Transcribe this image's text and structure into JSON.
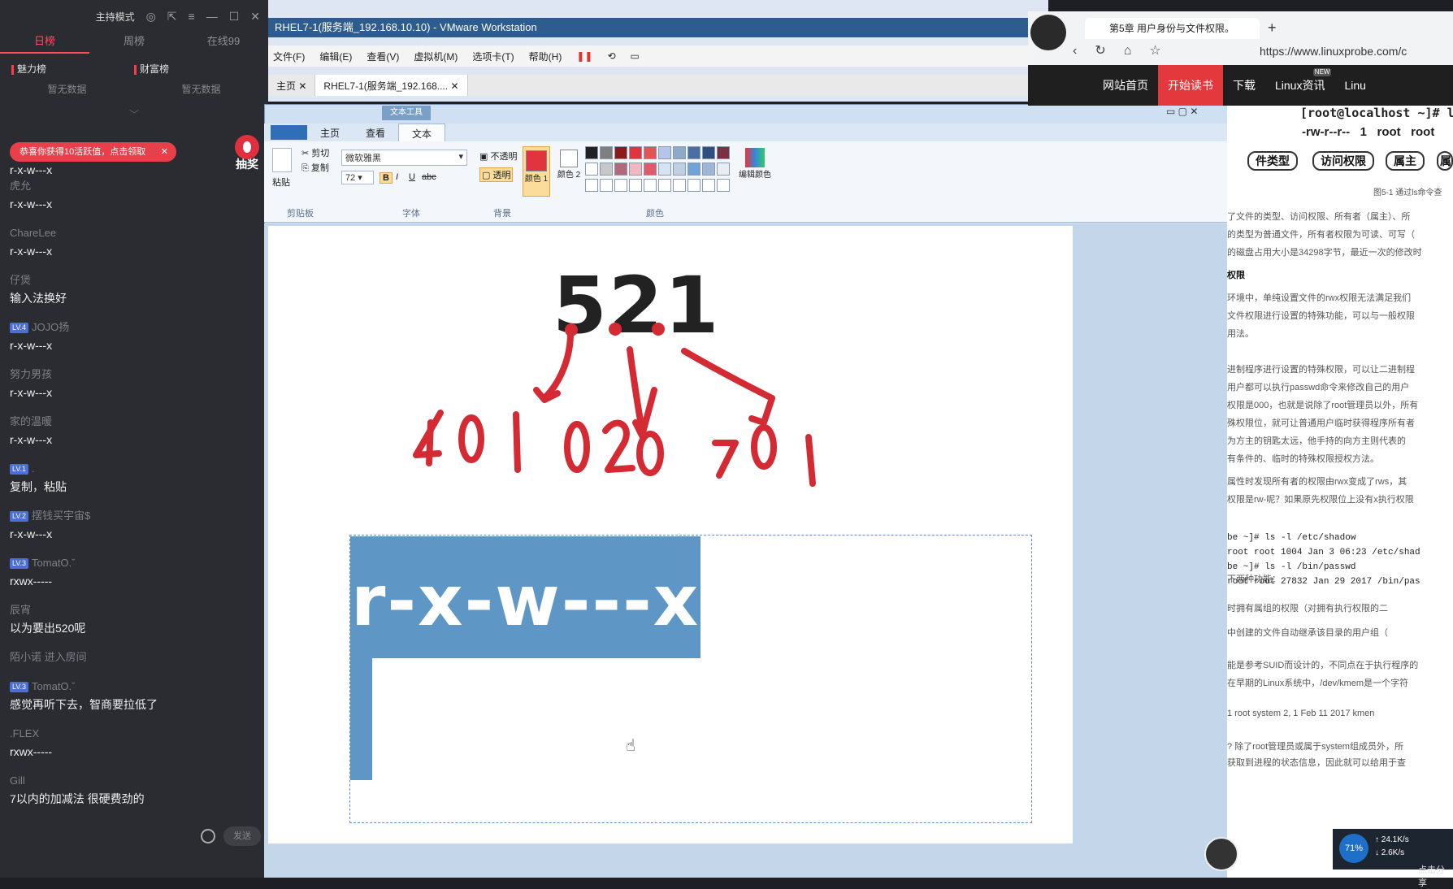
{
  "chat": {
    "mode_label": "主持模式",
    "tabs": [
      "日榜",
      "周榜",
      "在线99"
    ],
    "rank_left": "魅力榜",
    "rank_right": "财富榜",
    "empty_left": "暂无数据",
    "empty_right": "暂无数据",
    "promo": "恭喜你获得10活跃值，点击领取",
    "lottery": "抽奖",
    "messages": [
      {
        "user": "",
        "badge": "",
        "text": "r-x-w---x"
      },
      {
        "user": "虎允",
        "badge": "",
        "text": "r-x-w---x"
      },
      {
        "user": "ChareLee",
        "badge": "",
        "text": "r-x-w---x"
      },
      {
        "user": "仔煲",
        "badge": "",
        "text": "输入法换好"
      },
      {
        "user": "JOJO扬",
        "badge": "LV.4",
        "text": "r-x-w---x"
      },
      {
        "user": "努力男孩",
        "badge": "",
        "text": "r-x-w---x"
      },
      {
        "user": "家的温暖",
        "badge": "",
        "text": "r-x-w---x"
      },
      {
        "user": ".",
        "badge": "LV.1",
        "text": "复制，粘贴"
      },
      {
        "user": "摆钱买宇宙$",
        "badge": "LV.2",
        "text": "r-x-w---x"
      },
      {
        "user": "TomatO.ˇ",
        "badge": "LV.3",
        "text": "rxwx-----"
      },
      {
        "user": "辰宵",
        "badge": "",
        "text": "以为要出520呢"
      },
      {
        "user": "陌小诺 进入房间",
        "badge": "",
        "text": ""
      },
      {
        "user": "TomatO.ˇ",
        "badge": "LV.3",
        "text": "感觉再听下去，智商要拉低了"
      },
      {
        "user": ".FLEX",
        "badge": "",
        "text": "rxwx-----"
      },
      {
        "user": "Gill",
        "badge": "",
        "text": "7以内的加减法 很硬费劲的"
      }
    ],
    "send_label": "发送"
  },
  "vmware": {
    "title": "RHEL7-1(服务端_192.168.10.10) - VMware Workstation",
    "menu": [
      "文件(F)",
      "编辑(E)",
      "查看(V)",
      "虚拟机(M)",
      "选项卡(T)",
      "帮助(H)"
    ],
    "tabs": [
      "主页",
      "RHEL7-1(服务端_192.168...."
    ]
  },
  "paint": {
    "ribbon_tabs": [
      "主页",
      "查看",
      "文本"
    ],
    "text_tools_label": "文本工具",
    "clipboard": {
      "cut": "剪切",
      "copy": "复制",
      "paste": "粘贴",
      "group": "剪贴板"
    },
    "font": {
      "name": "微软雅黑",
      "size": "72",
      "group": "字体"
    },
    "background": {
      "opaque": "不透明",
      "transparent": "透明",
      "group": "背景"
    },
    "colors": {
      "color1": "颜色 1",
      "color2": "颜色 2",
      "edit": "编辑颜色",
      "group": "颜色",
      "accent": "#e0353f"
    },
    "big_number": "521",
    "permission_text": "r-x-w---x",
    "handwriting": "4 0 1 0 2 0 7 0 1"
  },
  "browser": {
    "tab_title": "第5章 用户身份与文件权限。",
    "url": "https://www.linuxprobe.com/c",
    "nav": [
      "网站首页",
      "开始读书",
      "下载",
      "Linux资讯",
      "Linu"
    ],
    "nav_badge": "NEW",
    "terminal_prompt": "[root@localhost ~]# ls -l in",
    "perm_line": "-rw-r--r--   1   root   root",
    "tags": [
      "件类型",
      "访问权限",
      "属主",
      "属"
    ],
    "figure_caption": "图5-1  通过ls命令查",
    "paragraphs": [
      "了文件的类型、访问权限、所有者（属主）、所",
      "的类型为普通文件，所有者权限为可读、可写（",
      "的磁盘占用大小是34298字节，最近一次的修改时",
      "权限",
      "环境中，单纯设置文件的rwx权限无法满足我们",
      "文件权限进行设置的特殊功能，可以与一般权限",
      "用法。",
      "进制程序进行设置的特殊权限，可以让二进制程",
      "用户都可以执行passwd命令来修改自己的用户",
      "权限是000，也就是说除了root管理员以外，所有",
      "殊权限位，就可让普通用户临时获得程序所有者",
      "为方主的钥匙太远，他手持的向方主则代表的",
      "有条件的、临时的特殊权限授权方法。",
      "属性时发现所有者的权限由rwx变成了rws，其",
      "权限是rw-呢？如果原先权限位上没有x执行权限",
      "下两种功能：",
      "时拥有属组的权限（对拥有执行权限的二",
      "中创建的文件自动继承该目录的用户组（",
      "能是参考SUID而设计的，不同点在于执行程序的",
      "在早期的Linux系统中，/dev/kmem是一个字符",
      "1 root system 2, 1 Feb 11 2017  kmen",
      "? 除了root管理员或属于system组成员外，所",
      "获取到进程的状态信息，因此就可以给用于查"
    ],
    "code": [
      "be ~]# ls -l /etc/shadow",
      "root root 1004 Jan 3 06:23 /etc/shad",
      "be ~]# ls -l /bin/passwd",
      "root root 27832 Jan 29 2017 /bin/pas"
    ]
  },
  "tray": {
    "cpu": "71%",
    "up": "24.1K/s",
    "down": "2.6K/s",
    "share": "点击分享"
  }
}
